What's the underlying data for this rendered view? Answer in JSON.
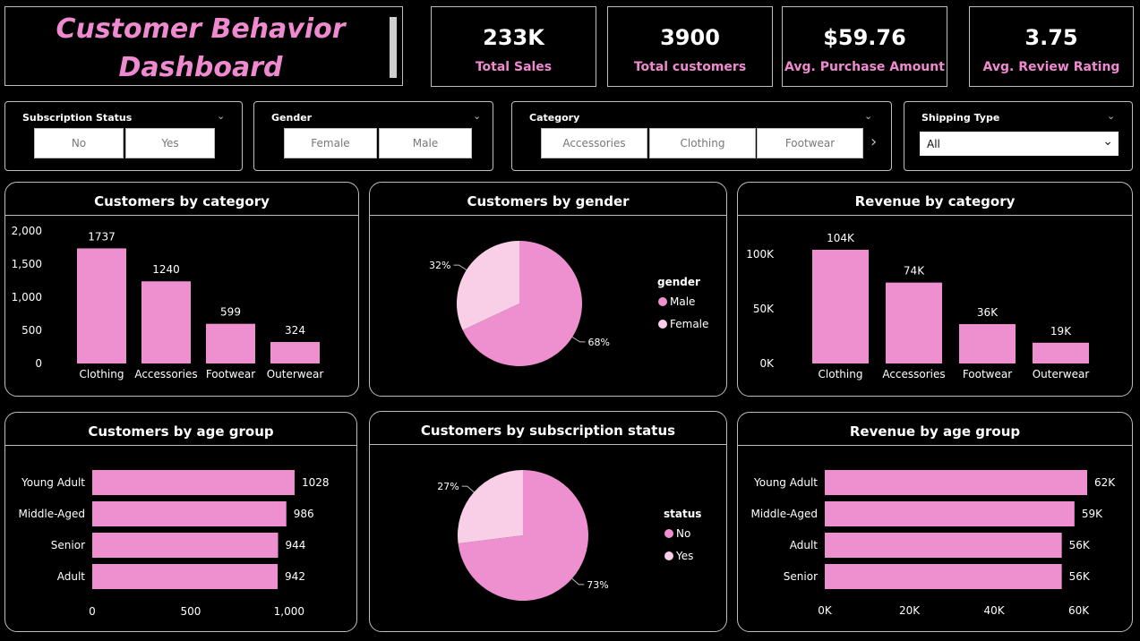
{
  "dashboard": {
    "title_line1": "Customer Behavior",
    "title_line2": "Dashboard"
  },
  "kpis": [
    {
      "value": "233K",
      "label": "Total Sales"
    },
    {
      "value": "3900",
      "label": "Total customers"
    },
    {
      "value": "$59.76",
      "label": "Avg. Purchase Amount"
    },
    {
      "value": "3.75",
      "label": "Avg. Review Rating"
    }
  ],
  "slicers": {
    "subscription": {
      "title": "Subscription Status",
      "options": [
        "No",
        "Yes"
      ]
    },
    "gender": {
      "title": "Gender",
      "options": [
        "Female",
        "Male"
      ]
    },
    "category": {
      "title": "Category",
      "options": [
        "Accessories",
        "Clothing",
        "Footwear"
      ],
      "next_icon": "chevron-right-icon"
    },
    "shipping": {
      "title": "Shipping Type",
      "selected": "All"
    }
  },
  "colors": {
    "accent": "#f08ad0",
    "bar": "#ee8fcf",
    "pie_light": "#f9cfe8",
    "background": "#000000",
    "border": "#bdbdbd"
  },
  "chart_data": [
    {
      "id": "customers_by_category",
      "type": "bar",
      "title": "Customers by category",
      "categories": [
        "Clothing",
        "Accessories",
        "Footwear",
        "Outerwear"
      ],
      "values": [
        1737,
        1240,
        599,
        324
      ],
      "data_labels": [
        "1737",
        "1240",
        "599",
        "324"
      ],
      "ylim": [
        0,
        2000
      ],
      "yticks": [
        0,
        500,
        1000,
        1500,
        2000
      ],
      "ytick_labels": [
        "0",
        "500",
        "1,000",
        "1,500",
        "2,000"
      ],
      "grid": false
    },
    {
      "id": "customers_by_gender",
      "type": "pie",
      "title": "Customers by gender",
      "legend_title": "gender",
      "legend_position": "right",
      "slices": [
        {
          "label": "Male",
          "value": 68,
          "label_text": "68%",
          "color": "#ee8fcf"
        },
        {
          "label": "Female",
          "value": 32,
          "label_text": "32%",
          "color": "#f9cfe8"
        }
      ]
    },
    {
      "id": "revenue_by_category",
      "type": "bar",
      "title": "Revenue by category",
      "categories": [
        "Clothing",
        "Accessories",
        "Footwear",
        "Outerwear"
      ],
      "values": [
        104000,
        74000,
        36000,
        19000
      ],
      "data_labels": [
        "104K",
        "74K",
        "36K",
        "19K"
      ],
      "ylim": [
        0,
        104000
      ],
      "yticks": [
        0,
        50000,
        100000
      ],
      "ytick_labels": [
        "0K",
        "50K",
        "100K"
      ],
      "grid": false
    },
    {
      "id": "customers_by_age_group",
      "type": "bar",
      "orientation": "horizontal",
      "title": "Customers by age group",
      "categories": [
        "Young Adult",
        "Middle-Aged",
        "Senior",
        "Adult"
      ],
      "values": [
        1028,
        986,
        944,
        942
      ],
      "data_labels": [
        "1028",
        "986",
        "944",
        "942"
      ],
      "xlim": [
        0,
        1060
      ],
      "xticks": [
        0,
        500,
        1000
      ],
      "xtick_labels": [
        "0",
        "500",
        "1,000"
      ],
      "grid": false
    },
    {
      "id": "customers_by_subscription_status",
      "type": "pie",
      "title": "Customers by subscription status",
      "legend_title": "status",
      "legend_position": "right",
      "slices": [
        {
          "label": "No",
          "value": 73,
          "label_text": "73%",
          "color": "#ee8fcf"
        },
        {
          "label": "Yes",
          "value": 27,
          "label_text": "27%",
          "color": "#f9cfe8"
        }
      ]
    },
    {
      "id": "revenue_by_age_group",
      "type": "bar",
      "orientation": "horizontal",
      "title": "Revenue by age group",
      "categories": [
        "Young Adult",
        "Middle-Aged",
        "Adult",
        "Senior"
      ],
      "values": [
        62000,
        59000,
        56000,
        56000
      ],
      "data_labels": [
        "62K",
        "59K",
        "56K",
        "56K"
      ],
      "xlim": [
        0,
        62000
      ],
      "xticks": [
        0,
        20000,
        40000,
        60000
      ],
      "xtick_labels": [
        "0K",
        "20K",
        "40K",
        "60K"
      ],
      "grid": false
    }
  ]
}
